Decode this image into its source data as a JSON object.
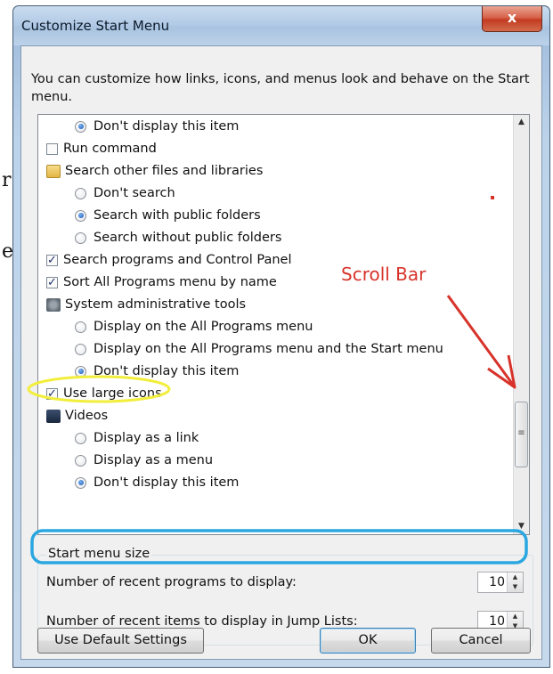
{
  "page_fragments": [
    "r",
    "e"
  ],
  "window": {
    "title": "Customize Start Menu",
    "close_glyph": "x"
  },
  "intro": "You can customize how links, icons, and menus look and behave on the Start menu.",
  "list": [
    {
      "type": "radio",
      "checked": true,
      "label": "Don't display this item"
    },
    {
      "type": "check",
      "checked": false,
      "label": "Run command"
    },
    {
      "type": "header",
      "icon": "folder-icon",
      "label": "Search other files and libraries"
    },
    {
      "type": "radio",
      "checked": false,
      "label": "Don't search"
    },
    {
      "type": "radio",
      "checked": true,
      "label": "Search with public folders"
    },
    {
      "type": "radio",
      "checked": false,
      "label": "Search without public folders"
    },
    {
      "type": "check",
      "checked": true,
      "label": "Search programs and Control Panel"
    },
    {
      "type": "check",
      "checked": true,
      "label": "Sort All Programs menu by name"
    },
    {
      "type": "header",
      "icon": "admin-tools-icon",
      "label": "System administrative tools"
    },
    {
      "type": "radio",
      "checked": false,
      "label": "Display on the All Programs menu"
    },
    {
      "type": "radio",
      "checked": false,
      "label": "Display on the All Programs menu and the Start menu"
    },
    {
      "type": "radio",
      "checked": true,
      "label": "Don't display this item"
    },
    {
      "type": "check",
      "checked": true,
      "label": "Use large icons"
    },
    {
      "type": "header",
      "icon": "video-icon",
      "label": "Videos"
    },
    {
      "type": "radio",
      "checked": false,
      "label": "Display as a link"
    },
    {
      "type": "radio",
      "checked": false,
      "label": "Display as a menu"
    },
    {
      "type": "radio",
      "checked": true,
      "label": "Don't display this item"
    }
  ],
  "start_menu_size": {
    "label": "Start menu size",
    "recent_programs": {
      "label": "Number of recent programs to display:",
      "value": "10"
    },
    "jump_list_items": {
      "label": "Number of recent items to display in Jump Lists:",
      "value": "10"
    }
  },
  "buttons": {
    "defaults": "Use Default Settings",
    "ok": "OK",
    "cancel": "Cancel"
  },
  "annotation": {
    "text": "Scroll Bar",
    "color": "#d7332a",
    "highlight_yellow": "#f2ee3c",
    "highlight_blue": "#2aa7e0"
  },
  "scrollbar": {
    "thumb_glyph": "≡"
  }
}
